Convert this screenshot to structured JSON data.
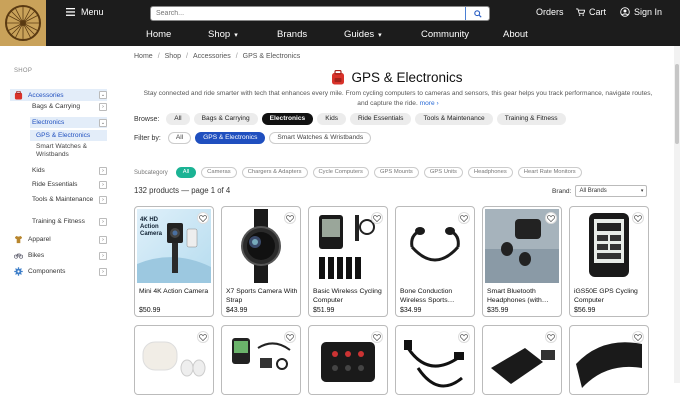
{
  "header": {
    "menu_label": "Menu",
    "search_placeholder": "Search...",
    "orders_label": "Orders",
    "cart_label": "Cart",
    "signin_label": "Sign In"
  },
  "nav": [
    {
      "label": "Home",
      "has_caret": false
    },
    {
      "label": "Shop",
      "has_caret": true
    },
    {
      "label": "Brands",
      "has_caret": false
    },
    {
      "label": "Guides",
      "has_caret": true
    },
    {
      "label": "Community",
      "has_caret": false
    },
    {
      "label": "About",
      "has_caret": false
    }
  ],
  "sidebar": {
    "heading": "SHOP",
    "items": [
      {
        "label": "Accessories",
        "icon": "backpack-icon",
        "toggle": "⌄",
        "level": 0,
        "active": true
      },
      {
        "label": "Bags & Carrying",
        "toggle": "›",
        "level": 1
      },
      {
        "label": "Electronics",
        "toggle": "⌄",
        "level": 1,
        "active": true
      },
      {
        "label": "GPS & Electronics",
        "level": 2,
        "current": true
      },
      {
        "label": "Smart Watches & Wristbands",
        "level": 2
      },
      {
        "label": "Kids",
        "toggle": "›",
        "level": 1
      },
      {
        "label": "Ride Essentials",
        "toggle": "›",
        "level": 1
      },
      {
        "label": "Tools & Maintenance",
        "toggle": "›",
        "level": 1
      },
      {
        "label": "Training & Fitness",
        "toggle": "›",
        "level": 1
      },
      {
        "label": "Apparel",
        "icon": "shirt-icon",
        "toggle": "›",
        "level": 0
      },
      {
        "label": "Bikes",
        "icon": "bike-icon",
        "toggle": "›",
        "level": 0
      },
      {
        "label": "Components",
        "icon": "gear-icon",
        "toggle": "›",
        "level": 0
      }
    ]
  },
  "breadcrumb": [
    "Home",
    "/",
    "Shop",
    "/",
    "Accessories",
    "/",
    "GPS & Electronics"
  ],
  "page": {
    "title": "GPS & Electronics",
    "description": "Stay connected and ride smarter with tech that enhances every mile. From cycling computers to cameras and sensors, this gear helps you track performance, navigate routes, and capture the ride.",
    "more_label": "more ›"
  },
  "browse": {
    "label": "Browse:",
    "pills": [
      {
        "label": "All",
        "on": false
      },
      {
        "label": "Bags & Carrying",
        "on": false
      },
      {
        "label": "Electronics",
        "on": true
      },
      {
        "label": "Kids",
        "on": false
      },
      {
        "label": "Ride Essentials",
        "on": false
      },
      {
        "label": "Tools & Maintenance",
        "on": false
      },
      {
        "label": "Training & Fitness",
        "on": false
      }
    ]
  },
  "filter": {
    "label": "Filter by:",
    "pills": [
      {
        "label": "All",
        "on": false
      },
      {
        "label": "GPS & Electronics",
        "on": true
      },
      {
        "label": "Smart Watches & Wristbands",
        "on": false
      }
    ]
  },
  "subcategory": {
    "label": "Subcategory",
    "pills": [
      {
        "label": "All",
        "on": true
      },
      {
        "label": "Cameras",
        "on": false
      },
      {
        "label": "Chargers & Adapters",
        "on": false
      },
      {
        "label": "Cycle Computers",
        "on": false
      },
      {
        "label": "GPS Mounts",
        "on": false
      },
      {
        "label": "GPS Units",
        "on": false
      },
      {
        "label": "Headphones",
        "on": false
      },
      {
        "label": "Heart Rate Monitors",
        "on": false
      }
    ]
  },
  "results": {
    "count_text": "132 products — page 1 of 4",
    "brand_label": "Brand:",
    "brand_value": "All Brands"
  },
  "products": [
    {
      "name": "Mini 4K Action Camera",
      "price": "$50.99",
      "image": "action-camera-image",
      "image_text": "4K HD Action Camera"
    },
    {
      "name": "X7 Sports Camera With Strap",
      "price": "$43.99",
      "image": "wrist-camera-image"
    },
    {
      "name": "Basic Wireless Cycling Computer",
      "price": "$51.99",
      "image": "cycling-computer-image"
    },
    {
      "name": "Bone Conduction Wireless Sports…",
      "price": "$34.99",
      "image": "bone-conduction-headphones-image"
    },
    {
      "name": "Smart Bluetooth Headphones (with…",
      "price": "$35.99",
      "image": "earbuds-image"
    },
    {
      "name": "iGS50E GPS Cycling Computer",
      "price": "$56.99",
      "image": "gps-computer-image"
    },
    {
      "name": "",
      "price": "",
      "image": "earbuds-case-image"
    },
    {
      "name": "",
      "price": "",
      "image": "computer-kit-image"
    },
    {
      "name": "",
      "price": "",
      "image": "battery-box-image"
    },
    {
      "name": "",
      "price": "",
      "image": "cables-image"
    },
    {
      "name": "",
      "price": "",
      "image": "car-charger-image"
    },
    {
      "name": "",
      "price": "",
      "image": "bike-mount-image"
    }
  ]
}
